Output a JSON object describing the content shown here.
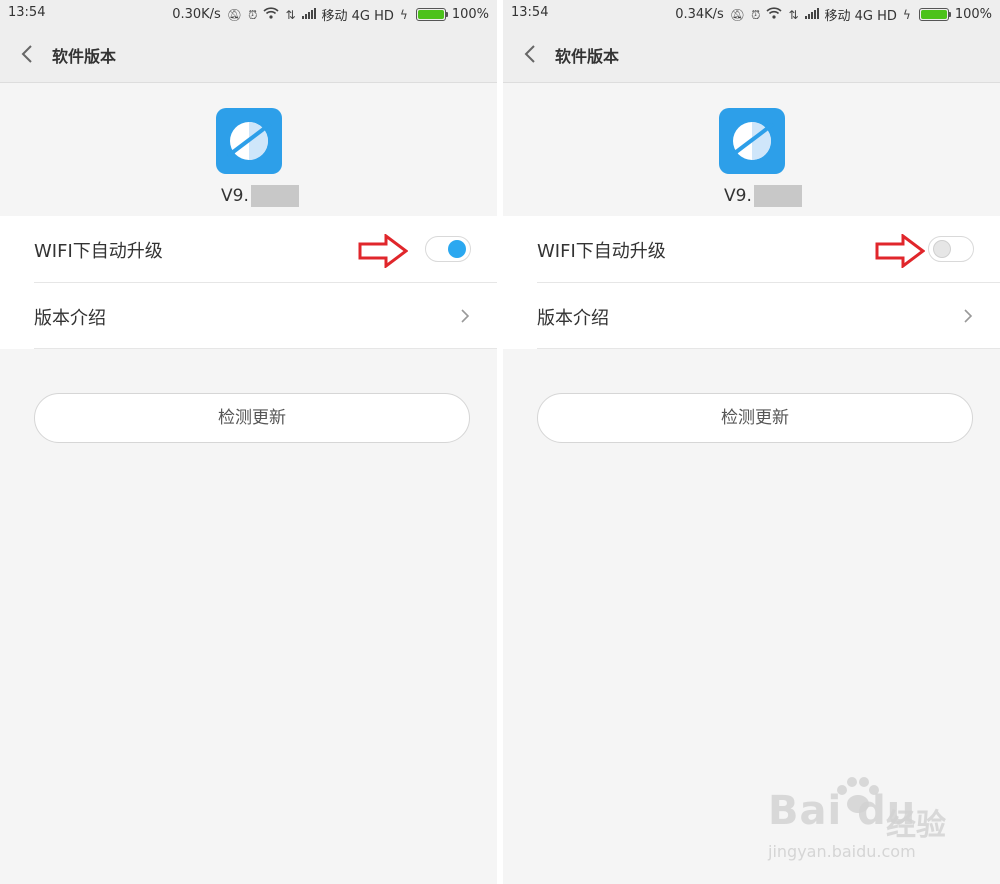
{
  "screens": [
    {
      "status": {
        "time": "13:54",
        "speed": "0.30K/s",
        "carrier": "移动 4G HD",
        "battery": "100%"
      },
      "title": "软件版本",
      "version_prefix": "V9.",
      "items": {
        "wifi_auto_update": "WIFI下自动升级",
        "version_intro": "版本介绍"
      },
      "toggle_state": "on",
      "check_button": "检测更新"
    },
    {
      "status": {
        "time": "13:54",
        "speed": "0.34K/s",
        "carrier": "移动 4G HD",
        "battery": "100%"
      },
      "title": "软件版本",
      "version_prefix": "V9.",
      "items": {
        "wifi_auto_update": "WIFI下自动升级",
        "version_intro": "版本介绍"
      },
      "toggle_state": "off",
      "check_button": "检测更新"
    }
  ],
  "colors": {
    "accent": "#2ba8f0",
    "app_icon": "#2d9fe9",
    "annotation_arrow": "#e0262b",
    "battery": "#4cc21a"
  },
  "watermark": {
    "logo": "Bai du",
    "suffix": "经验",
    "url": "jingyan.baidu.com"
  },
  "icons": [
    "back-arrow-icon",
    "chevron-right-icon",
    "app-planet-icon",
    "battery-icon",
    "wifi-icon",
    "alarm-icon",
    "red-arrow-icon"
  ]
}
